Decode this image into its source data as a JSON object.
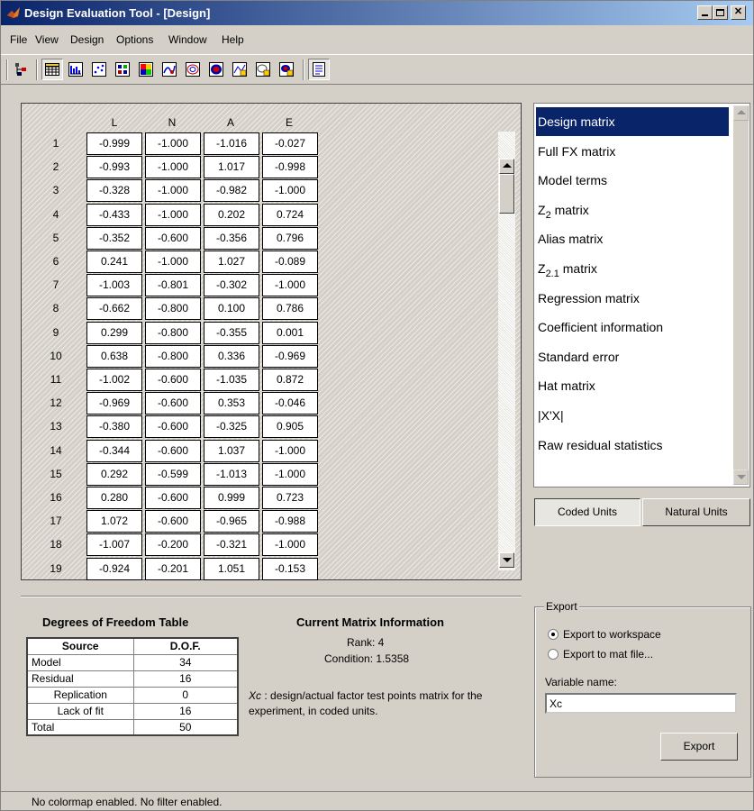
{
  "window": {
    "title": "Design Evaluation Tool - [Design]"
  },
  "menu": [
    "File",
    "View",
    "Design",
    "Options",
    "Window",
    "Help"
  ],
  "toolbar_icons": [
    "hierarchy-icon",
    "table-icon",
    "bar-chart-icon",
    "scatter-icon",
    "grid-plot-icon",
    "image-plot-icon",
    "surface-icon",
    "contour-icon",
    "filled-contour-icon",
    "multi-plot-icon",
    "cross-section-icon",
    "colored-cross-section-icon",
    "properties-icon"
  ],
  "matrix": {
    "columns": [
      "L",
      "N",
      "A",
      "E"
    ],
    "rows": [
      {
        "n": "1",
        "v": [
          "-0.999",
          "-1.000",
          "-1.016",
          "-0.027"
        ]
      },
      {
        "n": "2",
        "v": [
          "-0.993",
          "-1.000",
          "1.017",
          "-0.998"
        ]
      },
      {
        "n": "3",
        "v": [
          "-0.328",
          "-1.000",
          "-0.982",
          "-1.000"
        ]
      },
      {
        "n": "4",
        "v": [
          "-0.433",
          "-1.000",
          "0.202",
          "0.724"
        ]
      },
      {
        "n": "5",
        "v": [
          "-0.352",
          "-0.600",
          "-0.356",
          "0.796"
        ]
      },
      {
        "n": "6",
        "v": [
          "0.241",
          "-1.000",
          "1.027",
          "-0.089"
        ]
      },
      {
        "n": "7",
        "v": [
          "-1.003",
          "-0.801",
          "-0.302",
          "-1.000"
        ]
      },
      {
        "n": "8",
        "v": [
          "-0.662",
          "-0.800",
          "0.100",
          "0.786"
        ]
      },
      {
        "n": "9",
        "v": [
          "0.299",
          "-0.800",
          "-0.355",
          "0.001"
        ]
      },
      {
        "n": "10",
        "v": [
          "0.638",
          "-0.800",
          "0.336",
          "-0.969"
        ]
      },
      {
        "n": "11",
        "v": [
          "-1.002",
          "-0.600",
          "-1.035",
          "0.872"
        ]
      },
      {
        "n": "12",
        "v": [
          "-0.969",
          "-0.600",
          "0.353",
          "-0.046"
        ]
      },
      {
        "n": "13",
        "v": [
          "-0.380",
          "-0.600",
          "-0.325",
          "0.905"
        ]
      },
      {
        "n": "14",
        "v": [
          "-0.344",
          "-0.600",
          "1.037",
          "-1.000"
        ]
      },
      {
        "n": "15",
        "v": [
          "0.292",
          "-0.599",
          "-1.013",
          "-1.000"
        ]
      },
      {
        "n": "16",
        "v": [
          "0.280",
          "-0.600",
          "0.999",
          "0.723"
        ]
      },
      {
        "n": "17",
        "v": [
          "1.072",
          "-0.600",
          "-0.965",
          "-0.988"
        ]
      },
      {
        "n": "18",
        "v": [
          "-1.007",
          "-0.200",
          "-0.321",
          "-1.000"
        ]
      },
      {
        "n": "19",
        "v": [
          "-0.924",
          "-0.201",
          "1.051",
          "-0.153"
        ]
      }
    ]
  },
  "matrix_list": {
    "selected": "Design matrix",
    "items": [
      {
        "text": "Design matrix"
      },
      {
        "text": "Full FX matrix"
      },
      {
        "text": "Model terms"
      },
      {
        "text": "Z",
        "sub": "2",
        "rest": " matrix"
      },
      {
        "text": "Alias matrix"
      },
      {
        "text": "Z",
        "sub": "2.1",
        "rest": " matrix"
      },
      {
        "text": "Regression matrix"
      },
      {
        "text": "Coefficient information"
      },
      {
        "text": "Standard error"
      },
      {
        "text": "Hat matrix"
      },
      {
        "text": "|X'X|"
      },
      {
        "text": "Raw residual statistics"
      }
    ]
  },
  "units": {
    "coded": "Coded Units",
    "natural": "Natural Units",
    "active": "coded"
  },
  "dof": {
    "title": "Degrees of Freedom Table",
    "headers": [
      "Source",
      "D.O.F."
    ],
    "rows": [
      {
        "source": "Model",
        "dof": "34",
        "indent": false
      },
      {
        "source": "Residual",
        "dof": "16",
        "indent": false
      },
      {
        "source": "Replication",
        "dof": "0",
        "indent": true
      },
      {
        "source": "Lack of fit",
        "dof": "16",
        "indent": true
      },
      {
        "source": "Total",
        "dof": "50",
        "indent": false
      }
    ]
  },
  "info": {
    "title": "Current Matrix Information",
    "rank": "Rank: 4",
    "condition": "Condition: 1.5358",
    "desc_var": "Xc",
    "desc": " : design/actual factor test points matrix for the experiment, in coded units."
  },
  "export": {
    "legend": "Export",
    "option_workspace": "Export to workspace",
    "option_mat": "Export to mat file...",
    "selected": "workspace",
    "var_label": "Variable name:",
    "var_value": "Xc",
    "button": "Export"
  },
  "status": "No colormap enabled.  No filter enabled."
}
